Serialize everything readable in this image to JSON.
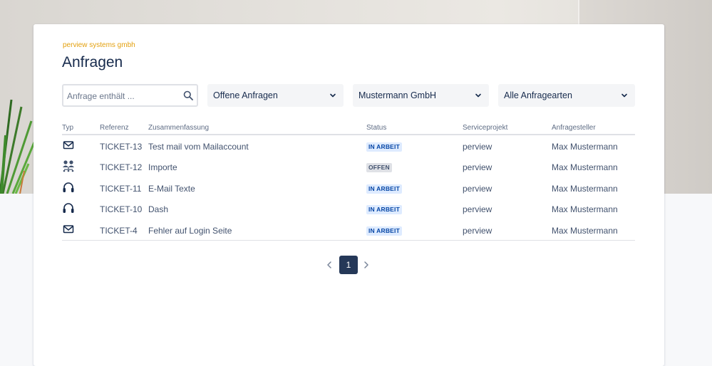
{
  "header": {
    "company": "perview systems gmbh",
    "title": "Anfragen"
  },
  "filters": {
    "search_placeholder": "Anfrage enthält ...",
    "status_select": "Offene Anfragen",
    "organization_select": "Mustermann GmbH",
    "type_select": "Alle Anfragearten"
  },
  "table": {
    "columns": {
      "typ": "Typ",
      "referenz": "Referenz",
      "zusammenfassung": "Zusammenfassung",
      "status": "Status",
      "serviceprojekt": "Serviceprojekt",
      "anfragesteller": "Anfragesteller"
    },
    "rows": [
      {
        "type_icon": "mail-icon",
        "ref": "TICKET-13",
        "summary": "Test mail vom Mailaccount",
        "status": "IN ARBEIT",
        "project": "perview",
        "requester": "Max Mustermann"
      },
      {
        "type_icon": "people-icon",
        "ref": "TICKET-12",
        "summary": "Importe",
        "status": "OFFEN",
        "project": "perview",
        "requester": "Max Mustermann"
      },
      {
        "type_icon": "headset-icon",
        "ref": "TICKET-11",
        "summary": "E-Mail Texte",
        "status": "IN ARBEIT",
        "project": "perview",
        "requester": "Max Mustermann"
      },
      {
        "type_icon": "headset-icon",
        "ref": "TICKET-10",
        "summary": "Dash",
        "status": "IN ARBEIT",
        "project": "perview",
        "requester": "Max Mustermann"
      },
      {
        "type_icon": "mail-icon",
        "ref": "TICKET-4",
        "summary": "Fehler auf Login Seite",
        "status": "IN ARBEIT",
        "project": "perview",
        "requester": "Max Mustermann"
      }
    ]
  },
  "pagination": {
    "current_page": "1"
  },
  "colors": {
    "accent": "#e3a00e",
    "page_active": "#253858",
    "badge_in_progress_bg": "#deebff",
    "badge_in_progress_text": "#0747a6",
    "badge_open_bg": "#dfe1e6"
  }
}
